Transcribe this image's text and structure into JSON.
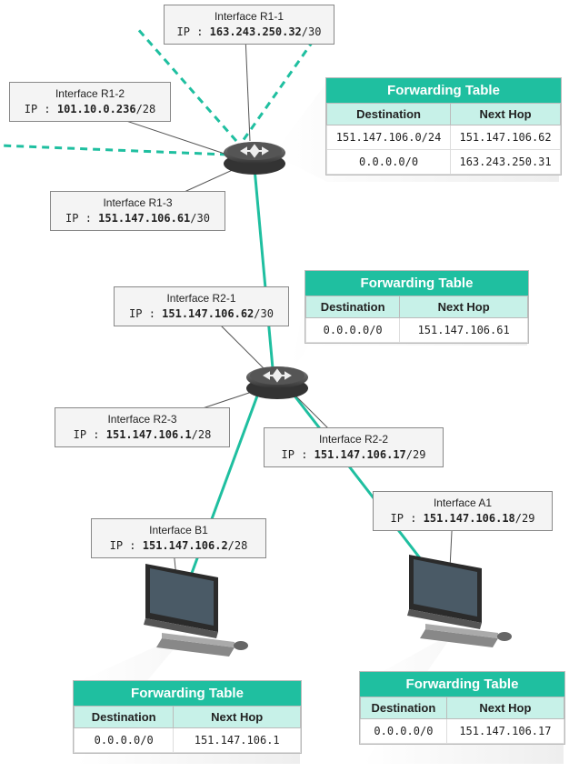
{
  "r1": {
    "if1": {
      "name": "Interface R1-1",
      "ip": "163.243.250.32",
      "mask": "/30"
    },
    "if2": {
      "name": "Interface R1-2",
      "ip": "101.10.0.236",
      "mask": "/28"
    },
    "if3": {
      "name": "Interface R1-3",
      "ip": "151.147.106.61",
      "mask": "/30"
    },
    "ft": {
      "title": "Forwarding Table",
      "cols": {
        "dest": "Destination",
        "hop": "Next Hop"
      },
      "rows": [
        {
          "dest": "151.147.106.0/24",
          "hop": "151.147.106.62"
        },
        {
          "dest": "0.0.0.0/0",
          "hop": "163.243.250.31"
        }
      ]
    }
  },
  "r2": {
    "if1": {
      "name": "Interface R2-1",
      "ip": "151.147.106.62",
      "mask": "/30"
    },
    "if2": {
      "name": "Interface R2-2",
      "ip": "151.147.106.17",
      "mask": "/29"
    },
    "if3": {
      "name": "Interface R2-3",
      "ip": "151.147.106.1",
      "mask": "/28"
    },
    "ft": {
      "title": "Forwarding Table",
      "cols": {
        "dest": "Destination",
        "hop": "Next Hop"
      },
      "rows": [
        {
          "dest": "0.0.0.0/0",
          "hop": "151.147.106.61"
        }
      ]
    }
  },
  "hostA": {
    "if": {
      "name": "Interface A1",
      "ip": "151.147.106.18",
      "mask": "/29"
    },
    "ft": {
      "title": "Forwarding Table",
      "cols": {
        "dest": "Destination",
        "hop": "Next Hop"
      },
      "rows": [
        {
          "dest": "0.0.0.0/0",
          "hop": "151.147.106.17"
        }
      ]
    }
  },
  "hostB": {
    "if": {
      "name": "Interface B1",
      "ip": "151.147.106.2",
      "mask": "/28"
    },
    "ft": {
      "title": "Forwarding Table",
      "cols": {
        "dest": "Destination",
        "hop": "Next Hop"
      },
      "rows": [
        {
          "dest": "0.0.0.0/0",
          "hop": "151.147.106.1"
        }
      ]
    }
  }
}
